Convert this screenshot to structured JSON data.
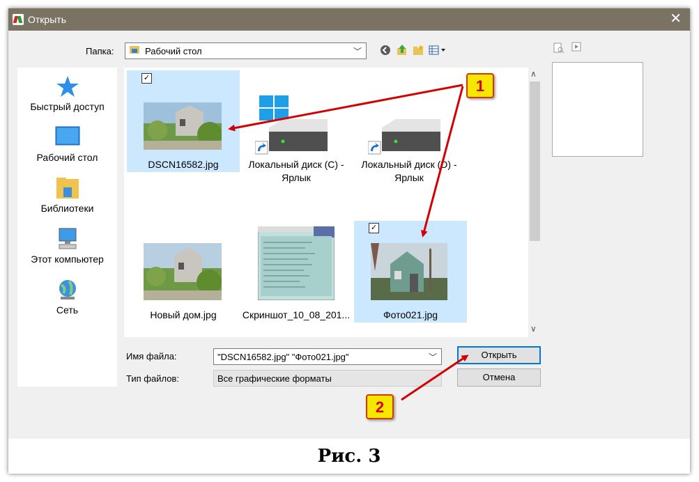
{
  "window": {
    "title": "Открыть",
    "close_glyph": "✕",
    "app_icon": "app-logo-icon"
  },
  "folder": {
    "label": "Папка:",
    "value": "Рабочий стол"
  },
  "sidebar": {
    "items": [
      {
        "label": "Быстрый доступ",
        "icon": "star-icon"
      },
      {
        "label": "Рабочий стол",
        "icon": "desktop-icon"
      },
      {
        "label": "Библиотеки",
        "icon": "libraries-icon"
      },
      {
        "label": "Этот компьютер",
        "icon": "computer-icon"
      },
      {
        "label": "Сеть",
        "icon": "network-icon"
      }
    ]
  },
  "files": [
    {
      "name": "DSCN16582.jpg",
      "selected": true,
      "kind": "photo"
    },
    {
      "name": "Локальный диск (C) - Ярлык",
      "selected": false,
      "kind": "drive-shortcut"
    },
    {
      "name": "Локальный диск (D) - Ярлык",
      "selected": false,
      "kind": "drive-shortcut"
    },
    {
      "name": "Новый дом.jpg",
      "selected": false,
      "kind": "photo"
    },
    {
      "name": "Скриншот_10_08_201...",
      "selected": false,
      "kind": "screenshot"
    },
    {
      "name": "Фото021.jpg",
      "selected": true,
      "kind": "photo"
    }
  ],
  "filename": {
    "label": "Имя файла:",
    "value": "\"DSCN16582.jpg\" \"Фото021.jpg\""
  },
  "filetype": {
    "label": "Тип файлов:",
    "value": "Все графические форматы"
  },
  "buttons": {
    "open": "Открыть",
    "cancel": "Отмена"
  },
  "annotations": {
    "badge1": "1",
    "badge2": "2"
  },
  "caption": "Рис. 3",
  "colors": {
    "titlebar": "#7a7262",
    "selection": "#cce8ff",
    "arrow": "#d40000",
    "badge_fill": "#f7e600"
  }
}
